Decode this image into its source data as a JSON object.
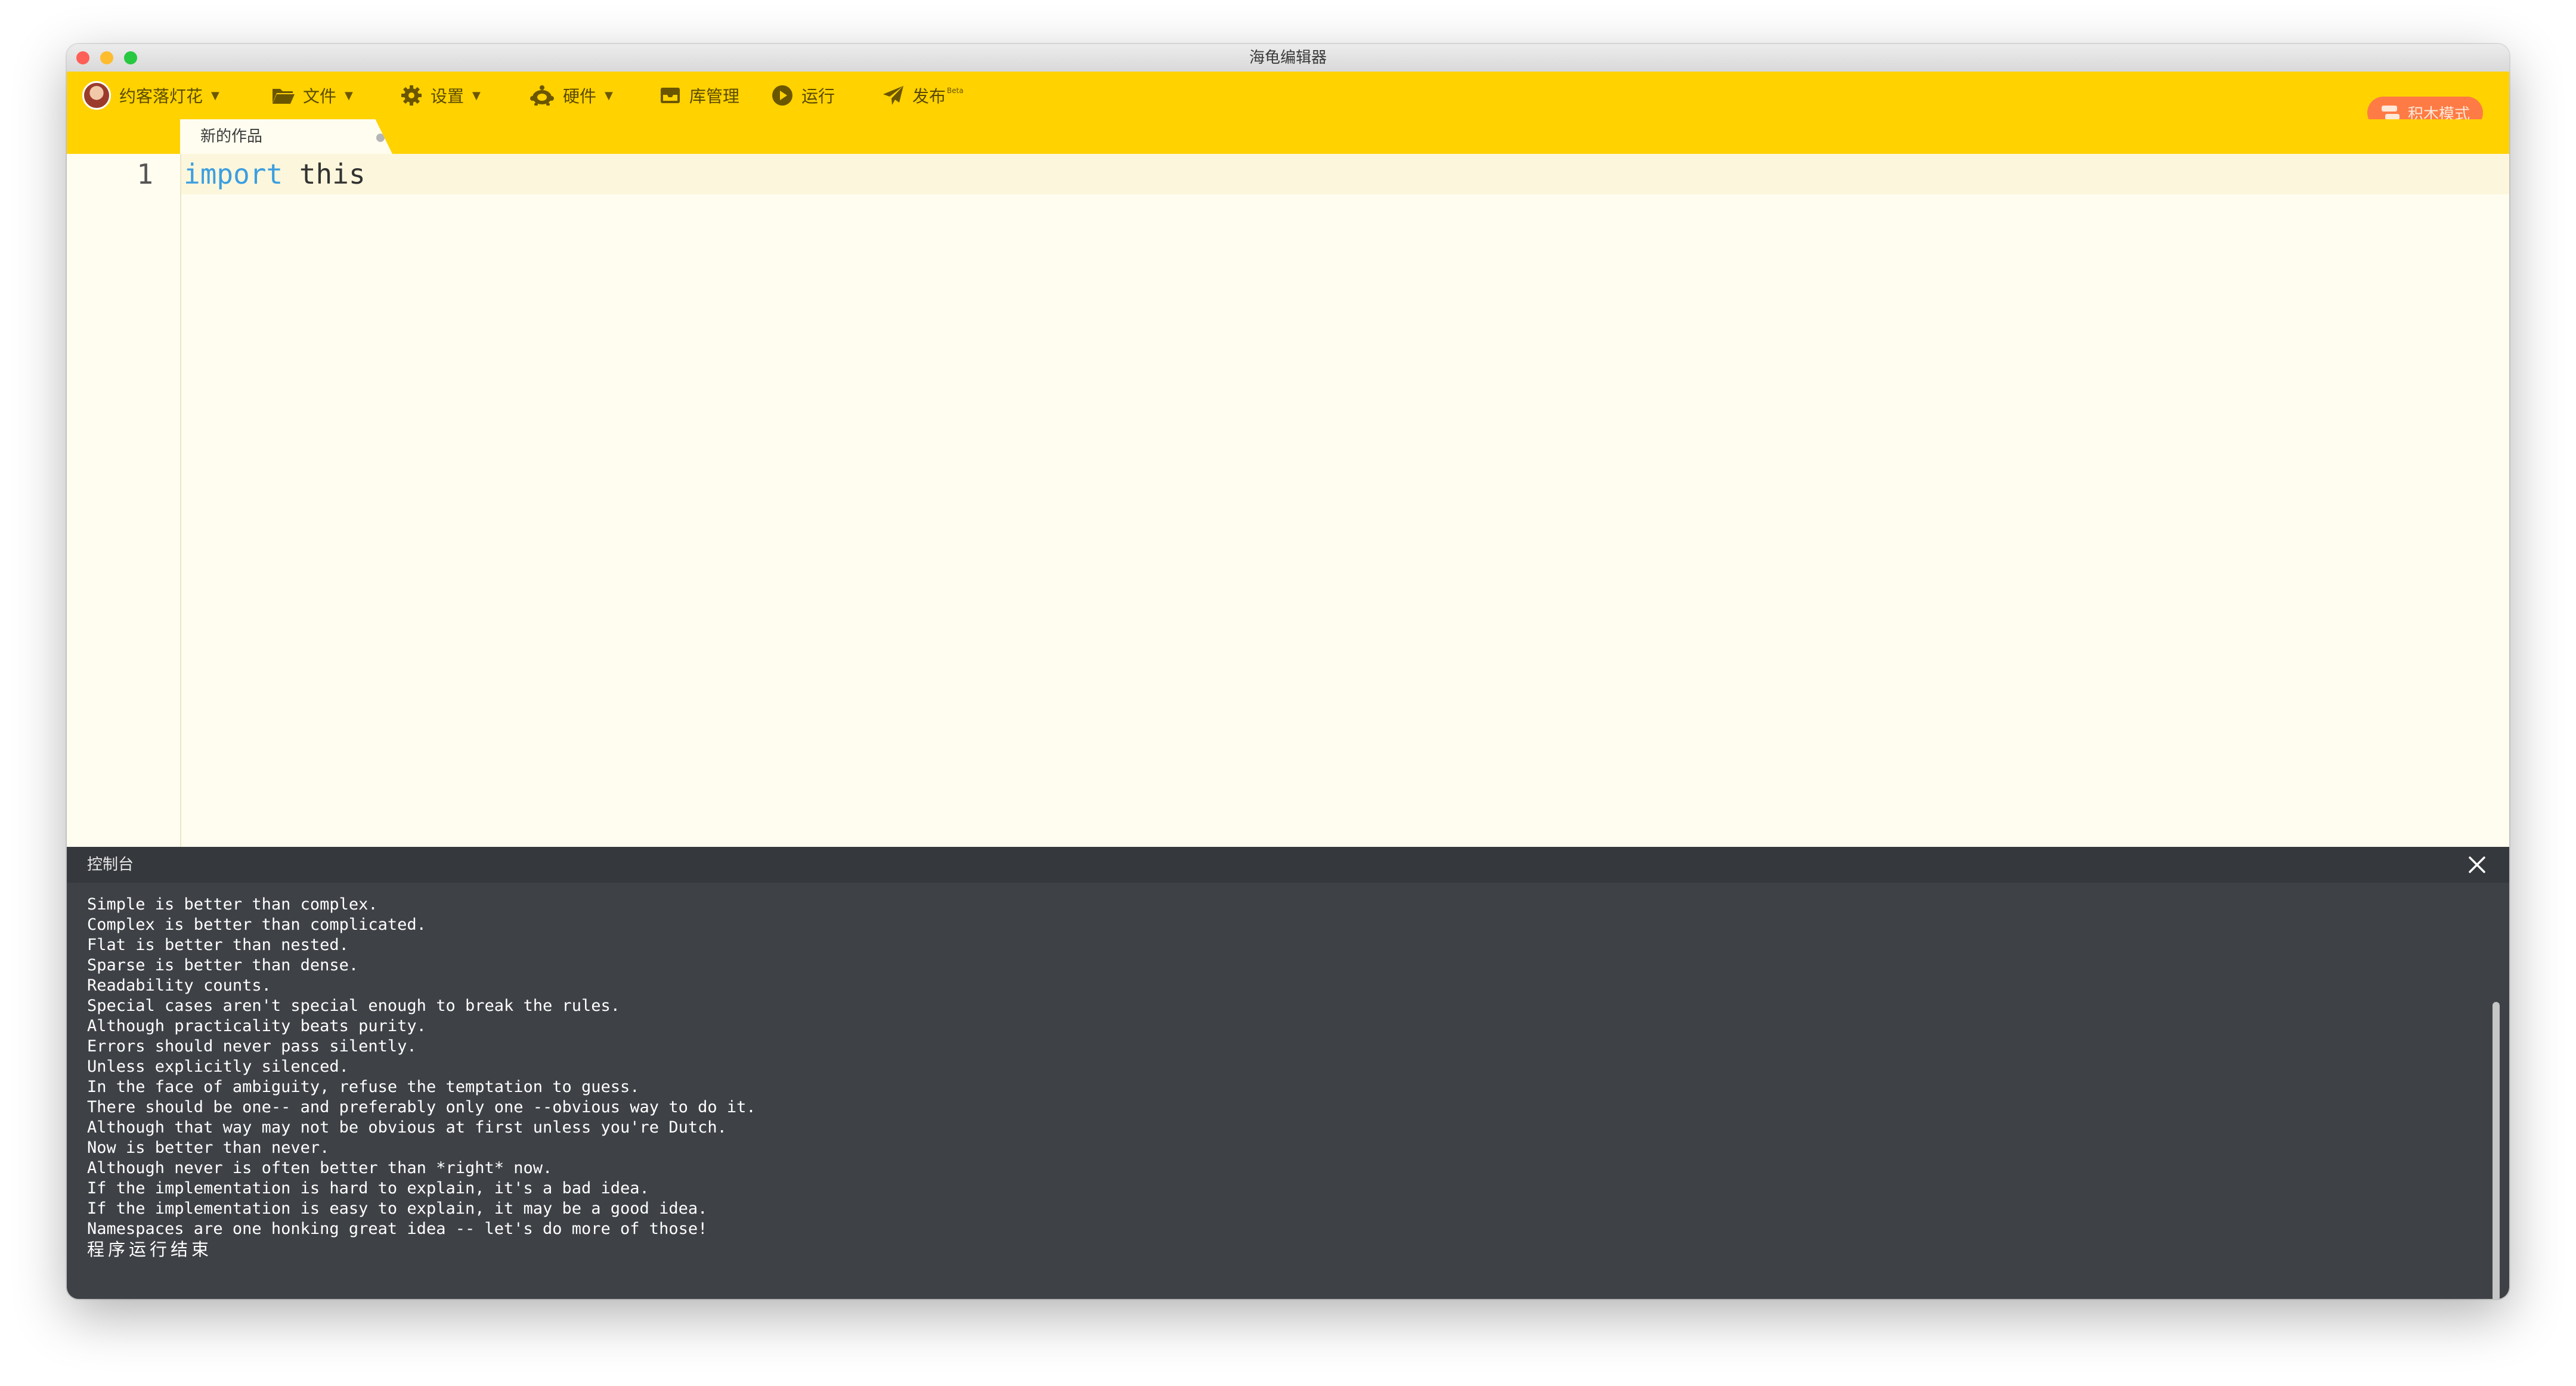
{
  "window": {
    "title": "海龟编辑器"
  },
  "menubar": {
    "user_label": "约客落灯花",
    "file_label": "文件",
    "settings_label": "设置",
    "hardware_label": "硬件",
    "library_label": "库管理",
    "run_label": "运行",
    "publish_label": "发布",
    "publish_badge": "Beta",
    "block_mode_label": "积木模式"
  },
  "tab": {
    "label": "新的作品"
  },
  "editor": {
    "line_numbers": [
      "1"
    ],
    "code_keyword": "import",
    "code_rest": " this",
    "run_button_label": "运行"
  },
  "console": {
    "title": "控制台",
    "lines": [
      "Simple is better than complex.",
      "Complex is better than complicated.",
      "Flat is better than nested.",
      "Sparse is better than dense.",
      "Readability counts.",
      "Special cases aren't special enough to break the rules.",
      "Although practicality beats purity.",
      "Errors should never pass silently.",
      "Unless explicitly silenced.",
      "In the face of ambiguity, refuse the temptation to guess.",
      "There should be one-- and preferably only one --obvious way to do it.",
      "Although that way may not be obvious at first unless you're Dutch.",
      "Now is better than never.",
      "Although never is often better than *right* now.",
      "If the implementation is hard to explain, it's a bad idea.",
      "If the implementation is easy to explain, it may be a good idea.",
      "Namespaces are one honking great idea -- let's do more of those!"
    ],
    "end_message": "程序运行结束"
  },
  "icons": {
    "close": "close-icon",
    "folder": "folder-icon",
    "gear": "gear-icon",
    "hardware": "hardware-icon",
    "library": "library-icon",
    "play": "play-icon",
    "send": "send-icon",
    "blocks": "blocks-icon"
  },
  "colors": {
    "menubar": "#ffd200",
    "editor_bg": "#fffdf0",
    "keyword": "#3d9ee0",
    "console_bg": "#3e4146",
    "block_mode_button": "#ff7b45",
    "run_button": "#ffc800"
  }
}
